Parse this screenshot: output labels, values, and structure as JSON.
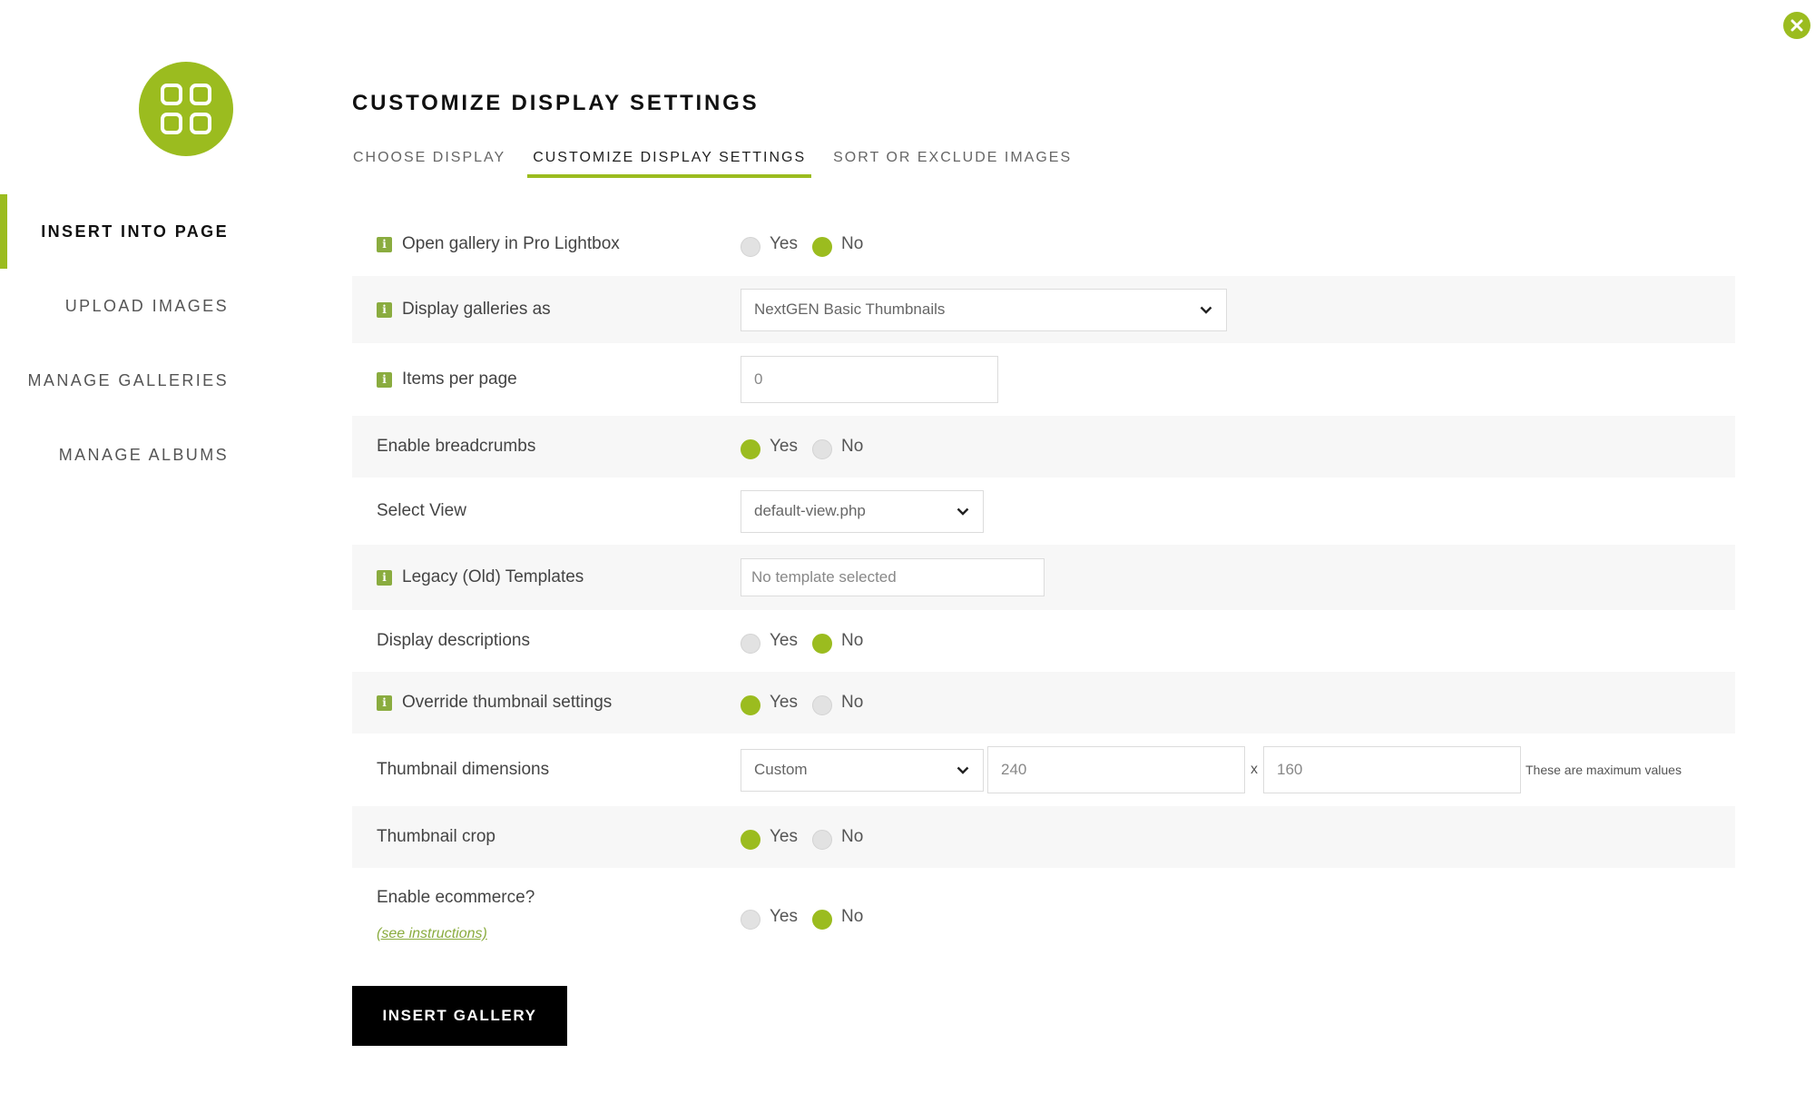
{
  "title": "CUSTOMIZE DISPLAY SETTINGS",
  "accent_color": "#9bbc1f",
  "sidebar": {
    "items": [
      {
        "label": "INSERT INTO PAGE",
        "active": true
      },
      {
        "label": "UPLOAD IMAGES",
        "active": false
      },
      {
        "label": "MANAGE GALLERIES",
        "active": false
      },
      {
        "label": "MANAGE ALBUMS",
        "active": false
      }
    ]
  },
  "tabs": [
    {
      "label": "CHOOSE DISPLAY",
      "active": false
    },
    {
      "label": "CUSTOMIZE DISPLAY SETTINGS",
      "active": true
    },
    {
      "label": "SORT OR EXCLUDE IMAGES",
      "active": false
    }
  ],
  "yes_label": "Yes",
  "no_label": "No",
  "settings": {
    "pro_lightbox": {
      "label": "Open gallery in Pro Lightbox",
      "value": "No"
    },
    "display_as": {
      "label": "Display galleries as",
      "value": "NextGEN Basic Thumbnails"
    },
    "items_per_page": {
      "label": "Items per page",
      "value": "0"
    },
    "breadcrumbs": {
      "label": "Enable breadcrumbs",
      "value": "Yes"
    },
    "select_view": {
      "label": "Select View",
      "value": "default-view.php"
    },
    "legacy_templates": {
      "label": "Legacy (Old) Templates",
      "placeholder": "No template selected"
    },
    "descriptions": {
      "label": "Display descriptions",
      "value": "No"
    },
    "override_thumb": {
      "label": "Override thumbnail settings",
      "value": "Yes"
    },
    "thumb_dimensions": {
      "label": "Thumbnail dimensions",
      "preset": "Custom",
      "width": "240",
      "separator": "x",
      "height": "160",
      "note": "These are maximum values"
    },
    "thumb_crop": {
      "label": "Thumbnail crop",
      "value": "Yes"
    },
    "ecommerce": {
      "label": "Enable ecommerce?",
      "link": "(see instructions)",
      "value": "No"
    }
  },
  "insert_button": "INSERT GALLERY",
  "icons": {
    "close": "close-icon",
    "logo": "grid-icon",
    "info": "info-icon",
    "dropdown": "chevron-down-icon"
  }
}
